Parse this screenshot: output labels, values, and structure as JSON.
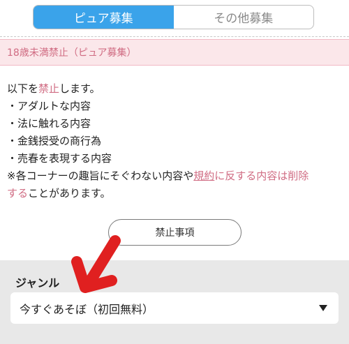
{
  "tabs": [
    {
      "label": "ピュア募集",
      "active": true
    },
    {
      "label": "その他募集",
      "active": false
    }
  ],
  "notice": {
    "title": "18歳未満禁止（ピュア募集）"
  },
  "rules": {
    "intro_prefix": "以下を",
    "intro_pink": "禁止",
    "intro_suffix": "します。",
    "items": [
      "・アダルトな内容",
      "・法に触れる内容",
      "・金銭授受の商行為",
      "・売春を表現する内容"
    ],
    "note_part1": "※各コーナーの趣旨にそぐわない内容や",
    "note_link": "規約",
    "note_part2": "に反する内容は削除",
    "note_line2_pink": "する",
    "note_line2_rest": "ことがあります。"
  },
  "ban_button": {
    "label": "禁止事項"
  },
  "genre": {
    "label": "ジャンル",
    "selected": "今すぐあそぼ（初回無料）"
  },
  "colors": {
    "tab_active": "#3aa3ea",
    "accent_pink": "#d06c83",
    "notice_bg": "#fbe7ea",
    "arrow_red": "#e02020",
    "panel_gray": "#e8e8e8"
  }
}
